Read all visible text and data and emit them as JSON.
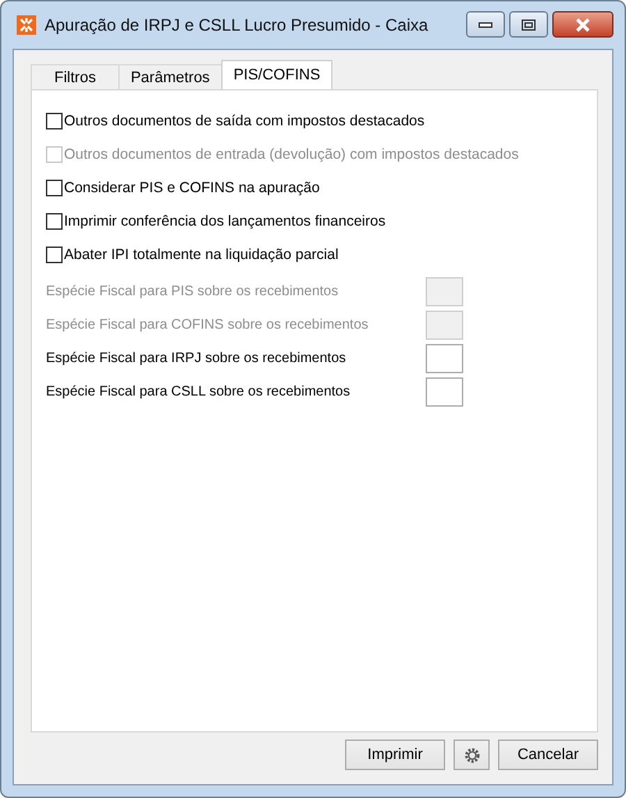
{
  "window": {
    "title": "Apuração de IRPJ e CSLL Lucro Presumido - Caixa"
  },
  "tabs": [
    {
      "label": "Filtros",
      "selected": false
    },
    {
      "label": "Parâmetros",
      "selected": false
    },
    {
      "label": "PIS/COFINS",
      "selected": true
    }
  ],
  "options": [
    {
      "label": "Outros documentos de saída com impostos destacados",
      "checked": false,
      "disabled": false
    },
    {
      "label": "Outros documentos de entrada (devolução) com impostos destacados",
      "checked": false,
      "disabled": true
    },
    {
      "label": "Considerar PIS e COFINS na apuração",
      "checked": false,
      "disabled": false
    },
    {
      "label": "Imprimir conferência dos lançamentos financeiros",
      "checked": false,
      "disabled": false
    },
    {
      "label": "Abater IPI totalmente na liquidação parcial",
      "checked": false,
      "disabled": false
    }
  ],
  "fields": [
    {
      "label": "Espécie Fiscal para PIS sobre os recebimentos",
      "disabled": true
    },
    {
      "label": "Espécie Fiscal para COFINS sobre os recebimentos",
      "disabled": true
    },
    {
      "label": "Espécie Fiscal para IRPJ sobre os recebimentos",
      "disabled": false
    },
    {
      "label": "Espécie Fiscal para CSLL sobre os recebimentos",
      "disabled": false
    }
  ],
  "buttons": {
    "print": "Imprimir",
    "cancel": "Cancelar"
  }
}
